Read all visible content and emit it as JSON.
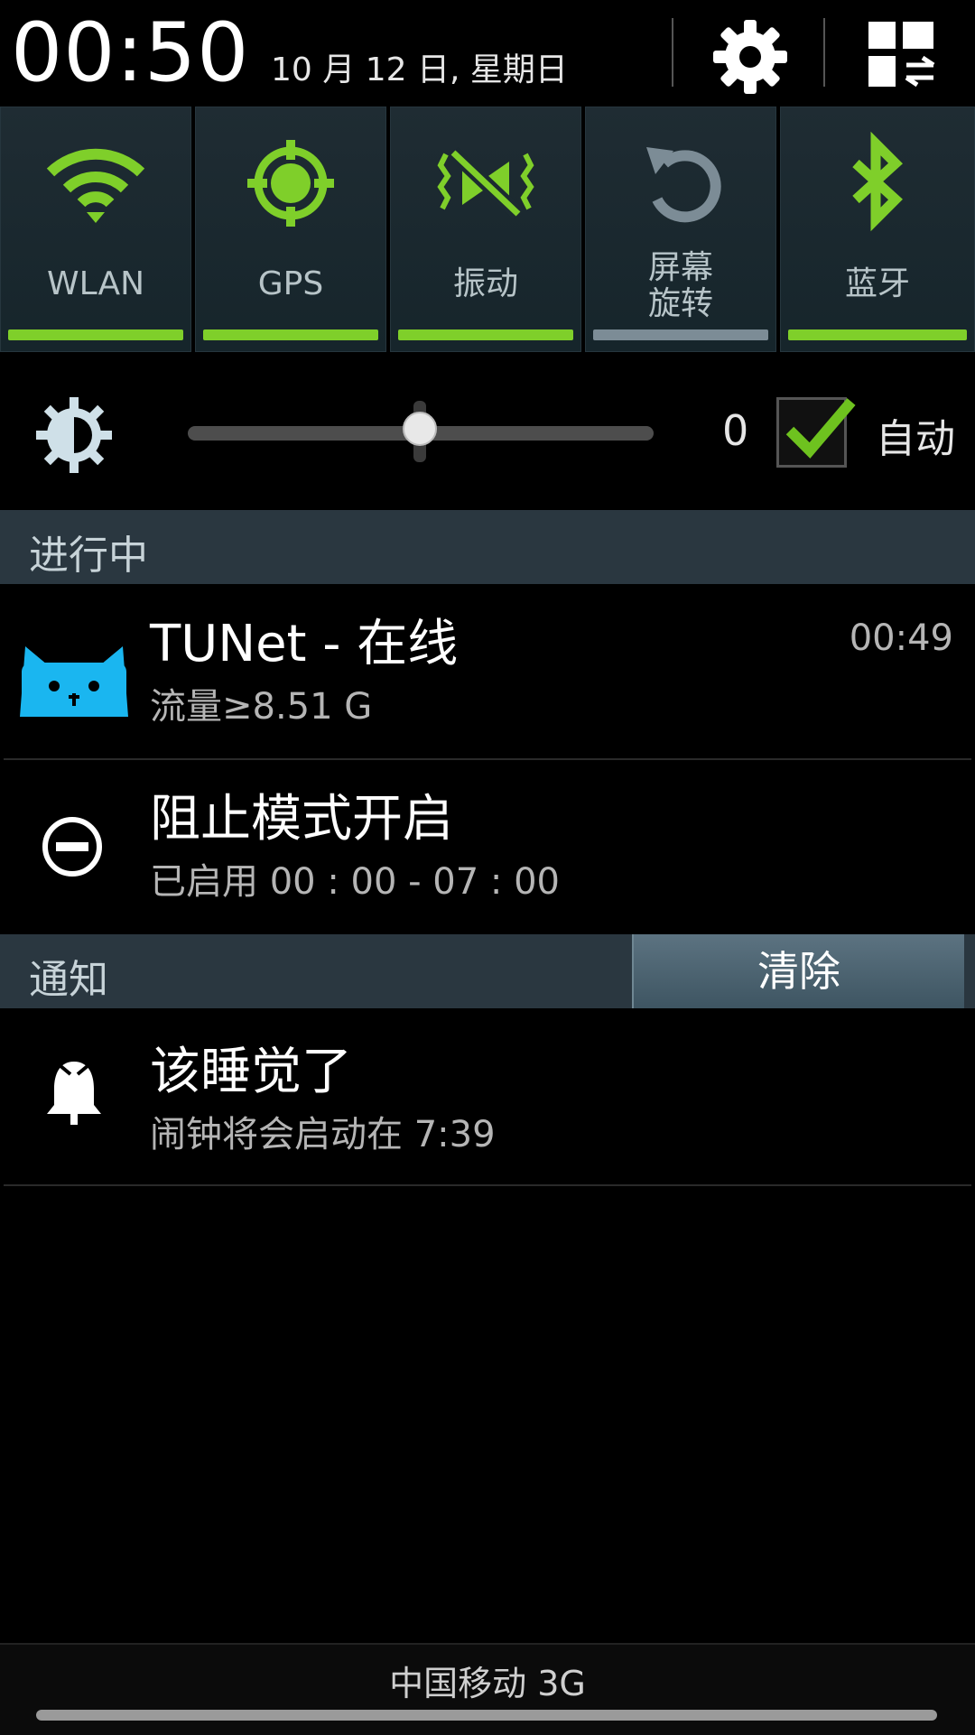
{
  "header": {
    "time": "00:50",
    "date": "10 月 12 日, 星期日",
    "settings_icon": "gear-icon",
    "layout_icon": "grid-switch-icon"
  },
  "toggles": [
    {
      "label": "WLAN",
      "icon": "wifi-icon",
      "on": true
    },
    {
      "label": "GPS",
      "icon": "gps-icon",
      "on": true
    },
    {
      "label": "振动",
      "icon": "vibrate-icon",
      "on": true
    },
    {
      "label": "屏幕\n旋转",
      "label_line1": "屏幕",
      "label_line2": "旋转",
      "icon": "rotate-icon",
      "on": false
    },
    {
      "label": "蓝牙",
      "icon": "bluetooth-icon",
      "on": true
    }
  ],
  "brightness": {
    "icon": "brightness-icon",
    "level": 0.5,
    "value": "0",
    "auto_label": "自动",
    "auto_checked": true
  },
  "ongoing": {
    "title": "进行中",
    "items": [
      {
        "title": "TUNet - 在线",
        "subtitle": "流量≥8.51 G",
        "time": "00:49",
        "icon": "tunet-cat-icon"
      },
      {
        "title": "阻止模式开启",
        "subtitle": "已启用 00 : 00  - 07 : 00",
        "icon": "block-icon"
      }
    ]
  },
  "notifications": {
    "title": "通知",
    "clear_label": "清除",
    "items": [
      {
        "title": "该睡觉了",
        "subtitle": "闹钟将会启动在 7:39",
        "icon": "bell-icon"
      }
    ]
  },
  "footer": {
    "carrier": "中国移动 3G"
  },
  "colors": {
    "accent_on": "#7fcf2a",
    "accent_off": "#7c8c96",
    "tile_bg": "#1c2a31",
    "section_bg": "#2a3740"
  }
}
